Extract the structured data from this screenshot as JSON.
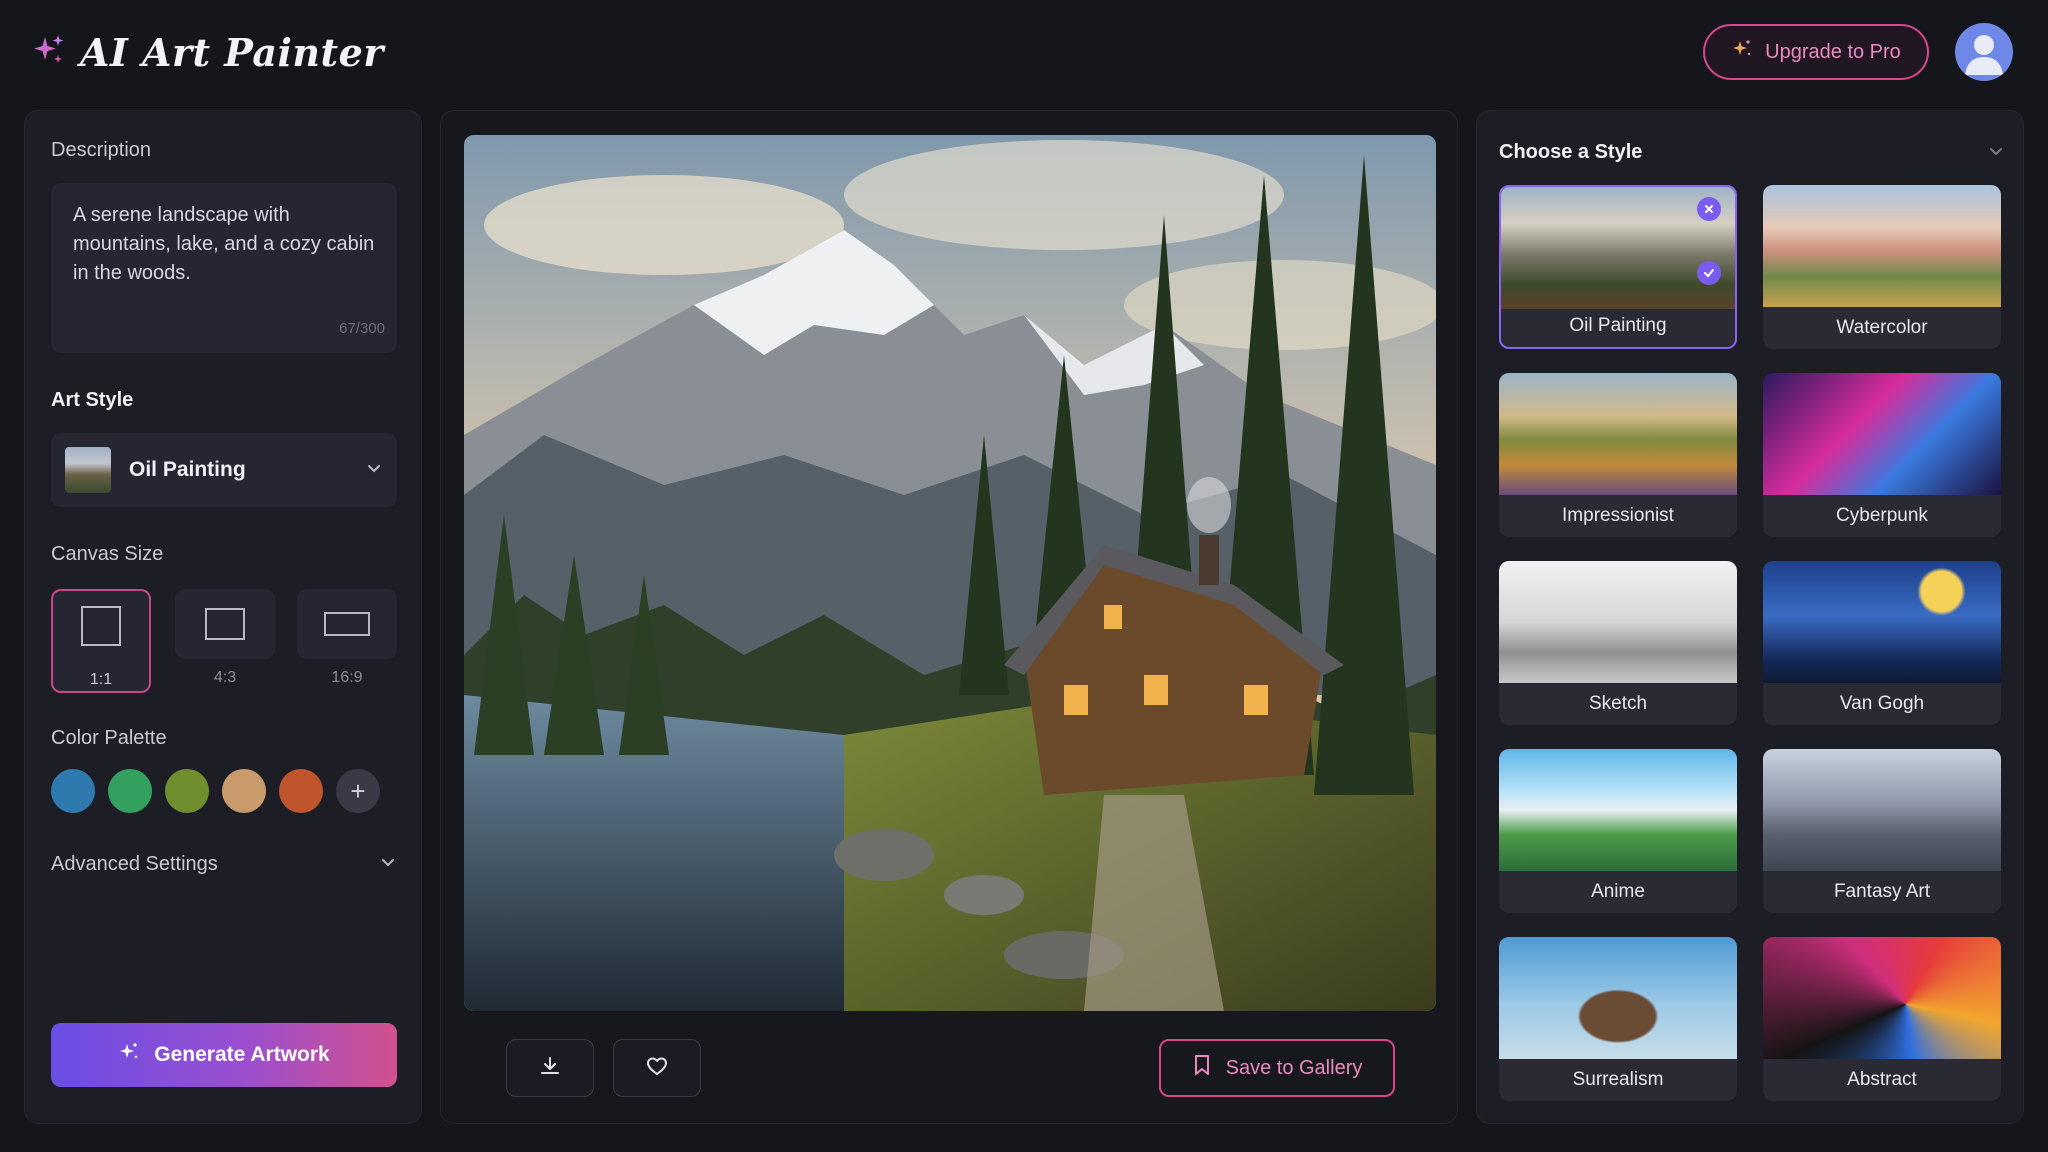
{
  "app": {
    "title": "AI Art Painter"
  },
  "header": {
    "upgrade_label": "Upgrade to Pro"
  },
  "left_panel": {
    "description_label": "Description",
    "description_text": "A serene landscape with mountains, lake, and a cozy cabin in the woods.",
    "char_count": "67/300",
    "art_style_label": "Art Style",
    "art_style_value": "Oil Painting",
    "canvas_size_label": "Canvas Size",
    "canvas_sizes": [
      {
        "label": "1:1",
        "selected": true
      },
      {
        "label": "4:3",
        "selected": false
      },
      {
        "label": "16:9",
        "selected": false
      }
    ],
    "color_palette_label": "Color Palette",
    "palette_colors": [
      "#2e79ad",
      "#33a05f",
      "#6f8f2f",
      "#c99a6b",
      "#c0552d"
    ],
    "advanced_label": "Advanced Settings",
    "generate_label": "Generate Artwork"
  },
  "center_panel": {
    "save_label": "Save to Gallery"
  },
  "right_panel": {
    "title": "Choose a Style",
    "styles": [
      {
        "name": "Oil Painting",
        "selected": true
      },
      {
        "name": "Watercolor",
        "selected": false
      },
      {
        "name": "Impressionist",
        "selected": false
      },
      {
        "name": "Cyberpunk",
        "selected": false
      },
      {
        "name": "Sketch",
        "selected": false
      },
      {
        "name": "Van Gogh",
        "selected": false
      },
      {
        "name": "Anime",
        "selected": false
      },
      {
        "name": "Fantasy Art",
        "selected": false
      },
      {
        "name": "Surrealism",
        "selected": false
      },
      {
        "name": "Abstract",
        "selected": false
      }
    ]
  },
  "colors": {
    "accent_pink": "#d9468c",
    "accent_purple": "#7b5cf0",
    "panel_bg": "#1d1d26"
  }
}
